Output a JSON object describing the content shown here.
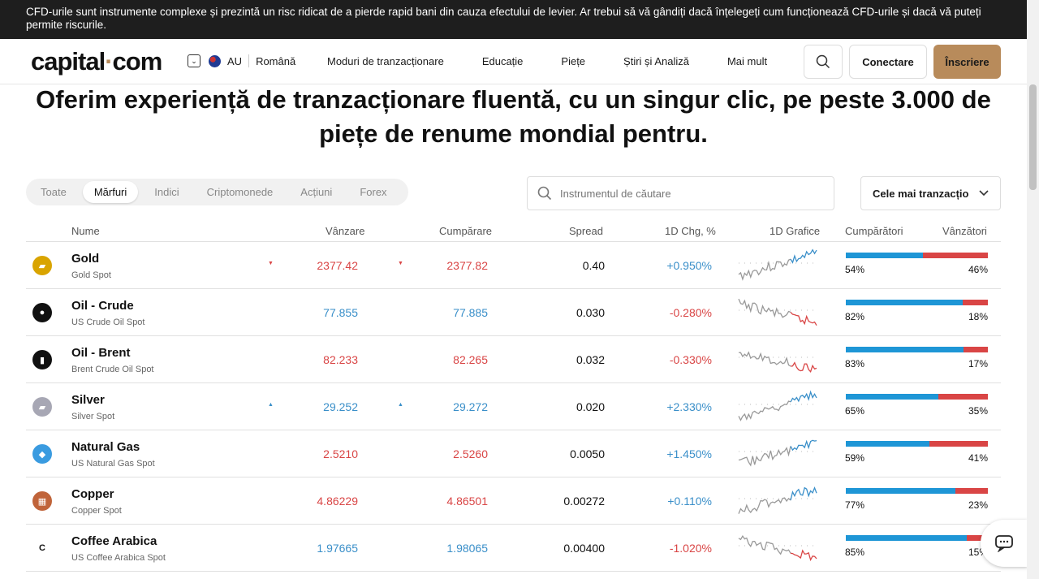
{
  "banner": {
    "text": "CFD-urile sunt instrumente complexe și prezintă un risc ridicat de a pierde rapid bani din cauza efectului de levier. Ar trebui să vă gândiți dacă înțelegeți cum funcționează CFD-urile și dacă vă puteți permite riscurile."
  },
  "header": {
    "logo_left": "capital",
    "logo_dot": "·",
    "logo_right": "com",
    "region": "AU",
    "language": "Română",
    "nav": [
      "Moduri de tranzacționare",
      "Educație",
      "Piețe",
      "Știri și Analiză",
      "Mai mult"
    ],
    "login": "Conectare",
    "signup": "Înscriere"
  },
  "headline": "Oferim experiență de tranzacționare fluentă, cu un singur clic, pe peste 3.000 de piețe de renume mondial pentru.",
  "tabs": [
    "Toate",
    "Mărfuri",
    "Indici",
    "Criptomonede",
    "Acțiuni",
    "Forex"
  ],
  "active_tab": "Mărfuri",
  "search": {
    "placeholder": "Instrumentul de căutare"
  },
  "sort": {
    "label": "Cele mai tranzacțio"
  },
  "table": {
    "headers": {
      "name": "Nume",
      "sell": "Vânzare",
      "buy": "Cumpărare",
      "spread": "Spread",
      "change": "1D Chg, %",
      "chart": "1D Grafice",
      "buyers": "Cumpărători",
      "sellers": "Vânzători"
    },
    "rows": [
      {
        "icon": "gold-icon",
        "name": "Gold",
        "sub": "Gold Spot",
        "sell": "2377.42",
        "buy": "2377.82",
        "spread": "0.40",
        "change": "+0.950%",
        "buyers": "54%",
        "sellers": "46%",
        "buyers_pct": 54,
        "price_color": "#d94545",
        "chg_color": "#3a8fc9",
        "arrow": "down",
        "trend": "up"
      },
      {
        "icon": "oil-drop-icon",
        "name": "Oil - Crude",
        "sub": "US Crude Oil Spot",
        "sell": "77.855",
        "buy": "77.885",
        "spread": "0.030",
        "change": "-0.280%",
        "buyers": "82%",
        "sellers": "18%",
        "buyers_pct": 82,
        "price_color": "#3a8fc9",
        "chg_color": "#d94545",
        "arrow": "",
        "trend": "down"
      },
      {
        "icon": "oil-barrel-icon",
        "name": "Oil - Brent",
        "sub": "Brent Crude Oil Spot",
        "sell": "82.233",
        "buy": "82.265",
        "spread": "0.032",
        "change": "-0.330%",
        "buyers": "83%",
        "sellers": "17%",
        "buyers_pct": 83,
        "price_color": "#d94545",
        "chg_color": "#d94545",
        "arrow": "",
        "trend": "down"
      },
      {
        "icon": "silver-icon",
        "name": "Silver",
        "sub": "Silver Spot",
        "sell": "29.252",
        "buy": "29.272",
        "spread": "0.020",
        "change": "+2.330%",
        "buyers": "65%",
        "sellers": "35%",
        "buyers_pct": 65,
        "price_color": "#3a8fc9",
        "chg_color": "#3a8fc9",
        "arrow": "up",
        "trend": "up"
      },
      {
        "icon": "gas-flame-icon",
        "name": "Natural Gas",
        "sub": "US Natural Gas Spot",
        "sell": "2.5210",
        "buy": "2.5260",
        "spread": "0.0050",
        "change": "+1.450%",
        "buyers": "59%",
        "sellers": "41%",
        "buyers_pct": 59,
        "price_color": "#d94545",
        "chg_color": "#3a8fc9",
        "arrow": "",
        "trend": "up"
      },
      {
        "icon": "copper-icon",
        "name": "Copper",
        "sub": "Copper Spot",
        "sell": "4.86229",
        "buy": "4.86501",
        "spread": "0.00272",
        "change": "+0.110%",
        "buyers": "77%",
        "sellers": "23%",
        "buyers_pct": 77,
        "price_color": "#d94545",
        "chg_color": "#3a8fc9",
        "arrow": "",
        "trend": "up"
      },
      {
        "icon": "coffee-icon",
        "name": "Coffee Arabica",
        "sub": "US Coffee Arabica Spot",
        "sell": "1.97665",
        "buy": "1.98065",
        "spread": "0.00400",
        "change": "-1.020%",
        "buyers": "85%",
        "sellers": "15%",
        "buyers_pct": 85,
        "price_color": "#3a8fc9",
        "chg_color": "#d94545",
        "arrow": "",
        "trend": "down"
      }
    ]
  },
  "colors": {
    "accent": "#b88b5b",
    "up": "#3a8fc9",
    "down": "#d94545",
    "buyers_bar": "#1e96d6",
    "sellers_bar": "#d94545"
  }
}
